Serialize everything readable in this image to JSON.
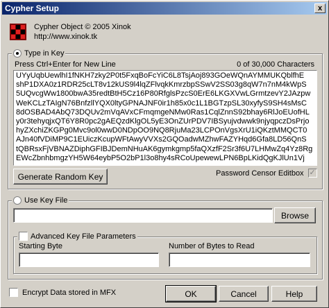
{
  "window": {
    "title": "Cypher Setup",
    "close_glyph": "x"
  },
  "about": {
    "line1": "Cypher Object © 2005 Xinok",
    "line2": "http://www.xinok.tk",
    "logo_icon": "cube-logo-icon"
  },
  "type_in_key": {
    "label": "Type in Key",
    "hint": "Press Ctrl+Enter for New Line",
    "char_count": "0 of 30,000 Characters",
    "key_lines": [
      "UYyUqbUewlhI1fNKH7zky2P0t5FxqBoFcYiC6L8TsjAoj893GOeWQnAYMMUKQblfhE",
      "shP1DXA0z1RDR25cLT8v12kUS9l4lqZFlvqkKmrzbpSSwV2SS03g8qW7n7nM4kWpS",
      "5UQvcgWw1800bwA35redtBtH5Cz16P80RfglsPzcS0ErE6LKGXVwLGrmtzevY2JAzpw",
      "WeKCLzTAIgN76BnfzllYQX0ltyGPNAJNF0ir1h85x0c1L1BGTzpSL30xyfyS9SH4sMsC",
      "8dOSBAD4AbQ73DQUv2mVqAVxCFmqmgeNMw0Ras1CqlZnnS92bhay6RlJoEUofHL",
      "y0r3tehyqjxQT6Y8R0pc2gAEQzdKlgOL5yE3OnZUrPDV7IBSyujvdwwk9njyqpczDsPrjo",
      "hyZXchiZKGPg0Mvc9ol0wwD0NDpOO9NQ8RjuMa23LCPOnVgsXrU1iQKztMMQCT0",
      "AJn40fVDiMP9C1EUiczKcupWFtAwyVVXs2GQOadwMZhwFAZYHqd6Gfa8LD56QnS",
      "tQBRsxFjVBNAZDiphGFIBJDemNHuAK6gymkgmp5faQXzfF2Sr3f6U7LHMwZq4Yz8Rg",
      "EWcZbnhbmgzYH5W64eybP5O2bP1l3o8hy4sRCoUpewewLPN6BpLKidQgKJlUn1Vj"
    ]
  },
  "buttons": {
    "generate": "Generate Random Key",
    "browse": "Browse",
    "ok": "OK",
    "cancel": "Cancel",
    "help": "Help"
  },
  "password_censor": {
    "label": "Password Censor Editbox",
    "checked_glyph": "✓"
  },
  "key_file": {
    "label": "Use Key File",
    "path_value": "",
    "advanced_label": "Advanced Key File Parameters",
    "starting_byte_label": "Starting Byte",
    "starting_byte_value": "",
    "bytes_to_read_label": "Number of Bytes to Read",
    "bytes_to_read_value": ""
  },
  "encrypt_mfx": {
    "label": "Encrypt Data stored in MFX"
  }
}
